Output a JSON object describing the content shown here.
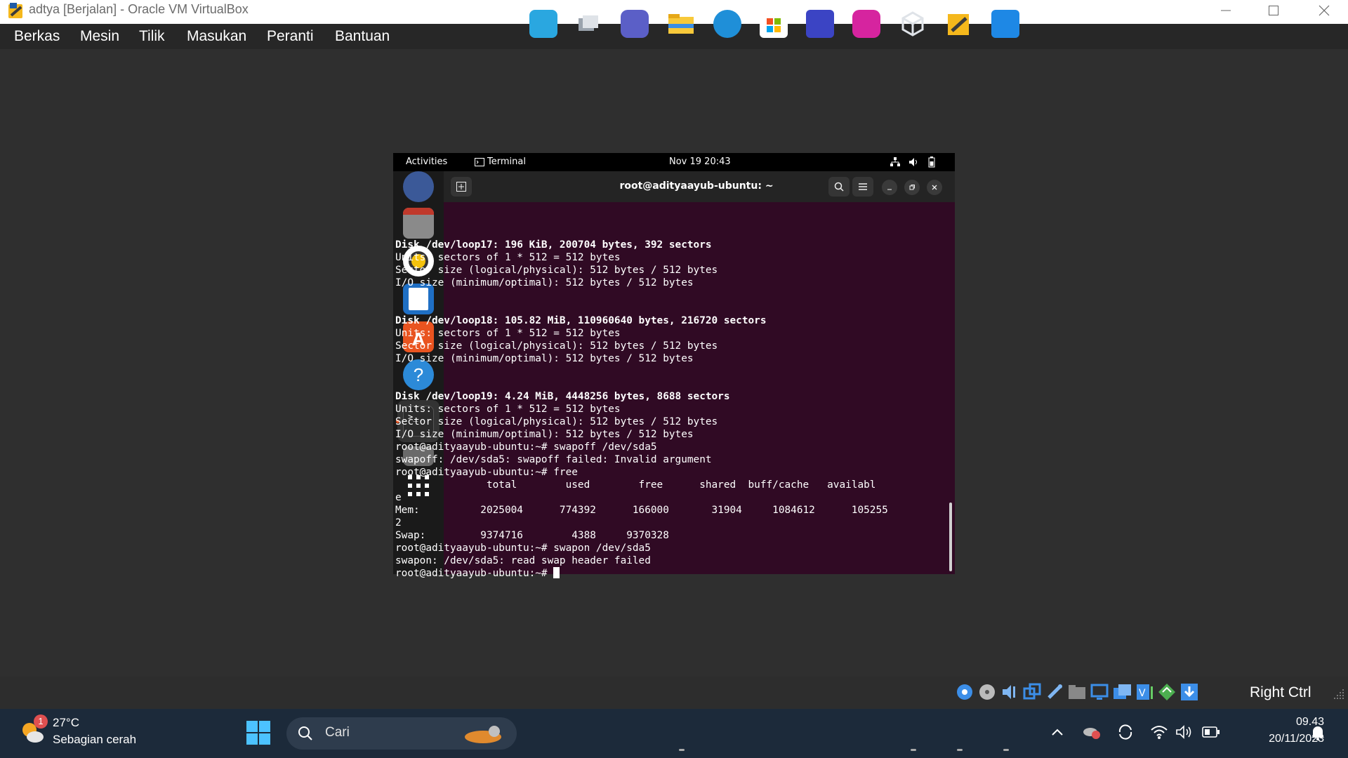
{
  "window": {
    "title": "adtya [Berjalan] - Oracle VM VirtualBox"
  },
  "menu": [
    "Berkas",
    "Mesin",
    "Tilik",
    "Masukan",
    "Peranti",
    "Bantuan"
  ],
  "guest": {
    "topbar": {
      "activities": "Activities",
      "app": "Terminal",
      "clock": "Nov 19  20:43"
    },
    "terminal": {
      "title": "root@adityaayub-ubuntu: ~",
      "lines": [
        {
          "t": "",
          "b": false
        },
        {
          "t": "Disk /dev/loop17: 196 KiB, 200704 bytes, 392 sectors",
          "b": true
        },
        {
          "t": "Units: sectors of 1 * 512 = 512 bytes",
          "b": false
        },
        {
          "t": "Sector size (logical/physical): 512 bytes / 512 bytes",
          "b": false
        },
        {
          "t": "I/O size (minimum/optimal): 512 bytes / 512 bytes",
          "b": false
        },
        {
          "t": "",
          "b": false
        },
        {
          "t": "",
          "b": false
        },
        {
          "t": "Disk /dev/loop18: 105.82 MiB, 110960640 bytes, 216720 sectors",
          "b": true
        },
        {
          "t": "Units: sectors of 1 * 512 = 512 bytes",
          "b": false
        },
        {
          "t": "Sector size (logical/physical): 512 bytes / 512 bytes",
          "b": false
        },
        {
          "t": "I/O size (minimum/optimal): 512 bytes / 512 bytes",
          "b": false
        },
        {
          "t": "",
          "b": false
        },
        {
          "t": "",
          "b": false
        },
        {
          "t": "Disk /dev/loop19: 4.24 MiB, 4448256 bytes, 8688 sectors",
          "b": true
        },
        {
          "t": "Units: sectors of 1 * 512 = 512 bytes",
          "b": false
        },
        {
          "t": "Sector size (logical/physical): 512 bytes / 512 bytes",
          "b": false
        },
        {
          "t": "I/O size (minimum/optimal): 512 bytes / 512 bytes",
          "b": false
        },
        {
          "t": "root@adityaayub-ubuntu:~# swapoff /dev/sda5",
          "b": false
        },
        {
          "t": "swapoff: /dev/sda5: swapoff failed: Invalid argument",
          "b": false
        },
        {
          "t": "root@adityaayub-ubuntu:~# free",
          "b": false
        },
        {
          "t": "               total        used        free      shared  buff/cache   availabl",
          "b": false
        },
        {
          "t": "e",
          "b": false
        },
        {
          "t": "Mem:          2025004      774392      166000       31904     1084612      105255",
          "b": false
        },
        {
          "t": "2",
          "b": false
        },
        {
          "t": "Swap:         9374716        4388     9370328",
          "b": false
        },
        {
          "t": "root@adityaayub-ubuntu:~# swapon /dev/sda5",
          "b": false
        },
        {
          "t": "swapon: /dev/sda5: read swap header failed",
          "b": false
        }
      ],
      "prompt": "root@adityaayub-ubuntu:~# "
    }
  },
  "statusbar": {
    "host_key": "Right Ctrl"
  },
  "taskbar": {
    "weather": {
      "temp": "27°C",
      "desc": "Sebagian cerah",
      "badge": "1"
    },
    "search_placeholder": "Cari",
    "clock": {
      "time": "09.43",
      "date": "20/11/2023"
    }
  },
  "colors": {
    "terminal_bg": "#300a24",
    "ubuntu_orange": "#e95420",
    "taskbar": "#1c2a3a"
  }
}
